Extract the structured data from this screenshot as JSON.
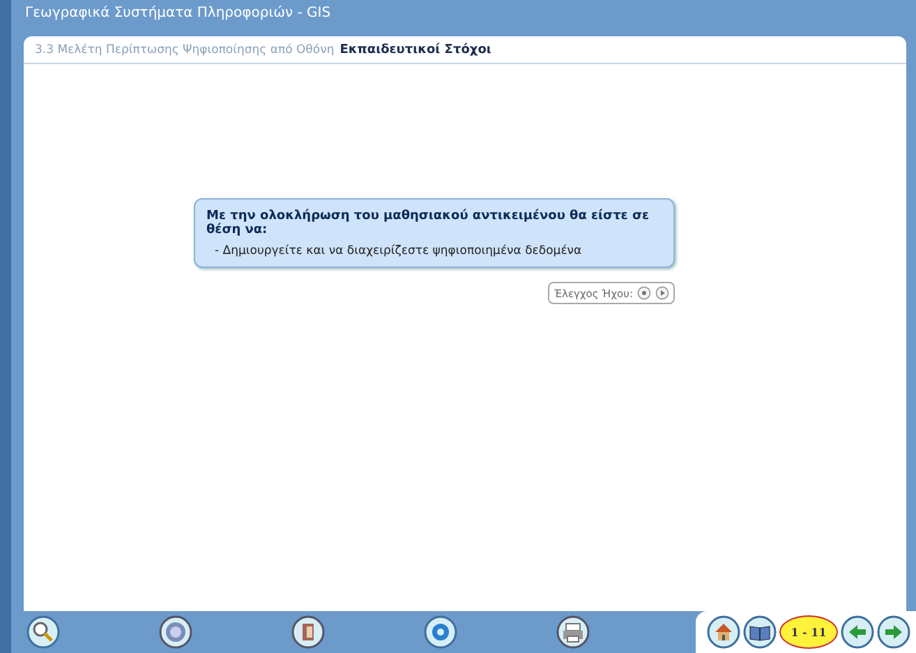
{
  "window": {
    "title": "Γεωγραφικά Συστήματα Πληροφοριών - GIS"
  },
  "breadcrumb": {
    "section": "3.3 Μελέτη Περίπτωσης Ψηφιοποίησης από Οθόνη",
    "current": "Εκπαιδευτικοί Στόχοι"
  },
  "objectives": {
    "heading": "Με την ολοκλήρωση του μαθησιακού αντικειμένου θα είστε σε θέση να:",
    "items": [
      "- Δημιουργείτε και να διαχειρίζεστε ψηφιοποιημένα δεδομένα"
    ]
  },
  "sound": {
    "label": "Έλεγχος Ήχου:"
  },
  "navigation": {
    "page": "1 - 11"
  }
}
